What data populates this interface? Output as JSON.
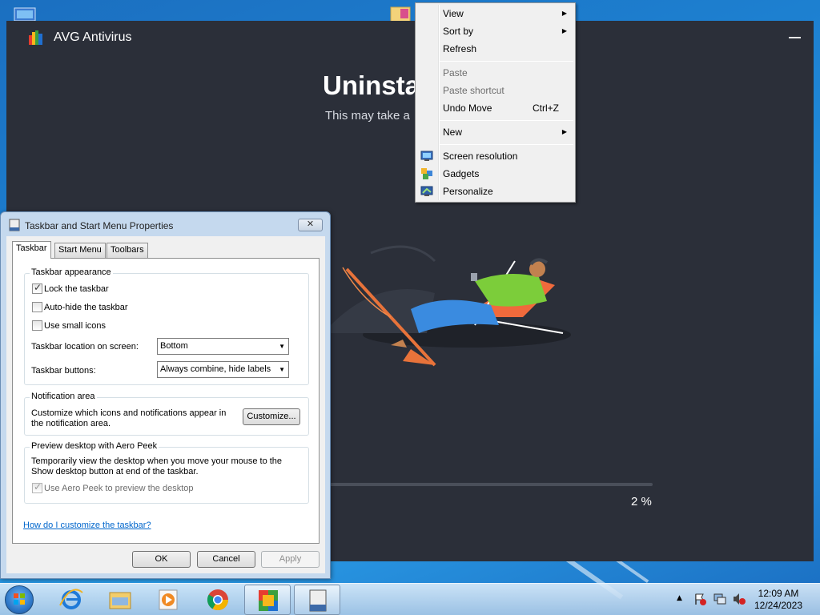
{
  "avg": {
    "app_title": "AVG Antivirus",
    "heading": "Uninsta",
    "subheading": "This may take a",
    "progress": 0.02,
    "progress_text": "2 %",
    "colors": {
      "background": "#2b2f39",
      "progress": "#23a25a"
    }
  },
  "context_menu": {
    "items": [
      {
        "label": "View",
        "submenu": true
      },
      {
        "label": "Sort by",
        "submenu": true
      },
      {
        "label": "Refresh"
      },
      {
        "label": "Paste",
        "disabled": true
      },
      {
        "label": "Paste shortcut",
        "disabled": true
      },
      {
        "label": "Undo Move",
        "shortcut": "Ctrl+Z"
      },
      {
        "label": "New",
        "submenu": true
      },
      {
        "label": "Screen resolution",
        "icon": "monitor-icon"
      },
      {
        "label": "Gadgets",
        "icon": "gadgets-icon"
      },
      {
        "label": "Personalize",
        "icon": "personalize-icon"
      }
    ]
  },
  "dialog": {
    "title": "Taskbar and Start Menu Properties",
    "close_glyph": "✕",
    "tabs": [
      "Taskbar",
      "Start Menu",
      "Toolbars"
    ],
    "appearance": {
      "label": "Taskbar appearance",
      "lock": {
        "label": "Lock the taskbar",
        "checked": true
      },
      "autohide": {
        "label": "Auto-hide the taskbar",
        "checked": false
      },
      "small_icons": {
        "label": "Use small icons",
        "checked": false
      },
      "location_label": "Taskbar location on screen:",
      "location_value": "Bottom",
      "buttons_label": "Taskbar buttons:",
      "buttons_value": "Always combine, hide labels"
    },
    "notification": {
      "label": "Notification area",
      "text": "Customize which icons and notifications appear in the notification area.",
      "customize_button": "Customize..."
    },
    "peek": {
      "label": "Preview desktop with Aero Peek",
      "text": "Temporarily view the desktop when you move your mouse to the Show desktop button at end of the taskbar.",
      "checkbox_label": "Use Aero Peek to preview the desktop",
      "checked": true,
      "disabled": true
    },
    "help_link": "How do I customize the taskbar?",
    "buttons": {
      "ok": "OK",
      "cancel": "Cancel",
      "apply": "Apply"
    }
  },
  "taskbar": {
    "pinned": [
      "start-orb-icon",
      "internet-explorer-icon",
      "file-explorer-icon",
      "media-player-icon",
      "chrome-icon",
      "avg-icon",
      "taskbar-properties-icon"
    ],
    "clock": {
      "time": "12:09 AM",
      "date": "12/24/2023"
    },
    "tray_icons": [
      "show-hidden-icons-chevron",
      "action-center-icon",
      "network-icon",
      "volume-muted-icon"
    ]
  }
}
